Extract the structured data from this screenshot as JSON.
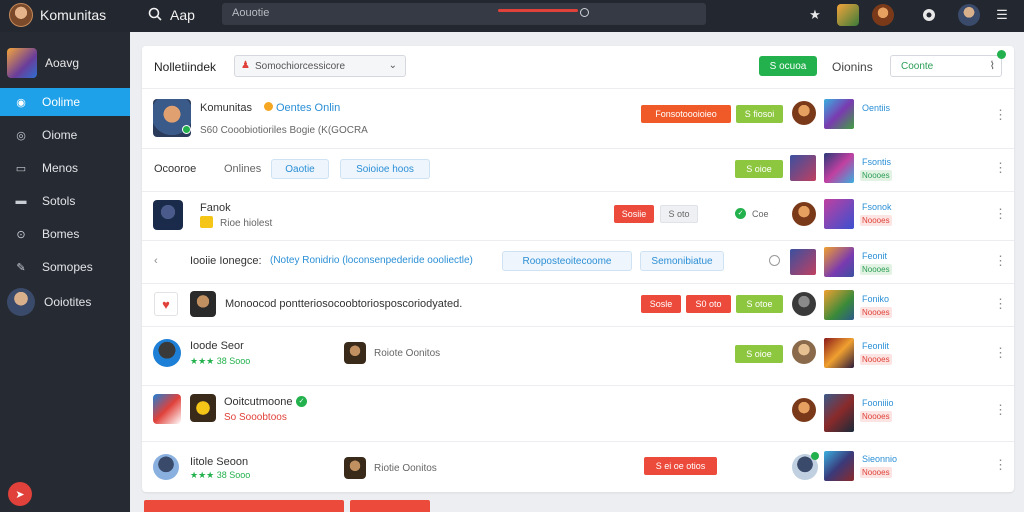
{
  "topbar": {
    "title": "Komunitas",
    "search_label": "Aap",
    "search_text": "Aouotie"
  },
  "sidebar": {
    "profile_name": "Aoavg",
    "items": [
      {
        "label": "Oolime",
        "icon": "camera-icon",
        "active": true
      },
      {
        "label": "Oiome",
        "icon": "circle-icon",
        "active": false
      },
      {
        "label": "Menos",
        "icon": "chat-icon",
        "active": false
      },
      {
        "label": "Sotols",
        "icon": "folder-icon",
        "active": false
      },
      {
        "label": "Bomes",
        "icon": "globe-icon",
        "active": false
      },
      {
        "label": "Somopes",
        "icon": "wrench-icon",
        "active": false
      }
    ],
    "user_label": "Ooiotites"
  },
  "panel": {
    "title": "Nolletiindek",
    "select_value": "Somochiorcessicore",
    "green_button": "S ocuoa",
    "online_label": "Oionins",
    "filter_value": "Coonte",
    "rows": [
      {
        "name": "Komunitas",
        "link": "Oentes Onlin",
        "sub": "S60 Cooobiotioriles Bogie (K(GOCRA",
        "btn_orange": "Fonsotoooioieo",
        "btn_lime": "S fiosoi",
        "side_title": "Oentiis"
      },
      {
        "label1": "Ocooroe",
        "label2": "Onlines",
        "btn_blue1": "Oaotie",
        "btn_blue2": "Soioioe hoos",
        "btn_lime": "S oioe",
        "side_title": "Fsontis",
        "side_tag": "Noooes"
      },
      {
        "name": "Fanok",
        "sub": "Rioe hiolest",
        "btn_red": "Sosiie",
        "btn_grey": "S oto",
        "btn_status": "Coe",
        "side_title": "Fsonok",
        "side_tag": "Noooes"
      },
      {
        "prefix": "Iooiie Ionegce:",
        "link": "(Notey Ronidrio (loconsenpederide oooliectle)",
        "btn_blue1": "Rooposteoitecoome",
        "btn_blue2": "Semonibiatue",
        "side_title": "Feonit",
        "side_tag": "Noooes"
      },
      {
        "text": "Monoocod pontteriosocoobtoriosposcoriodyated.",
        "btn_red": "Sosle",
        "btn_red2": "S0 oto",
        "btn_lime": "S otoe",
        "side_title": "Foniko",
        "side_tag": "Noooes"
      },
      {
        "name": "Ioode Seor",
        "stars": "★★★ 38 Sooo",
        "mid_text": "Roiote Oonitos",
        "btn_lime": "S oioe",
        "side_title": "Feonlit",
        "side_tag": "Noooes"
      },
      {
        "name": "Ooitcutmoone",
        "sub": "So Sooobtoos",
        "side_title": "Fooniiio",
        "side_tag": "Noooes"
      },
      {
        "name": "Iitole Seoon",
        "stars": "★★★ 38 Sooo",
        "mid_text": "Riotie Oonitos",
        "btn_red": "S ei oe otios",
        "side_title": "Sieonnio",
        "side_tag": "Noooes"
      }
    ]
  },
  "colors": {
    "topbar_bg": "#23272f",
    "sidebar_bg": "#262a32",
    "accent_blue": "#1ea1e8",
    "accent_red": "#ec4a3a",
    "accent_green": "#22b14c",
    "accent_lime": "#8dc63f"
  }
}
